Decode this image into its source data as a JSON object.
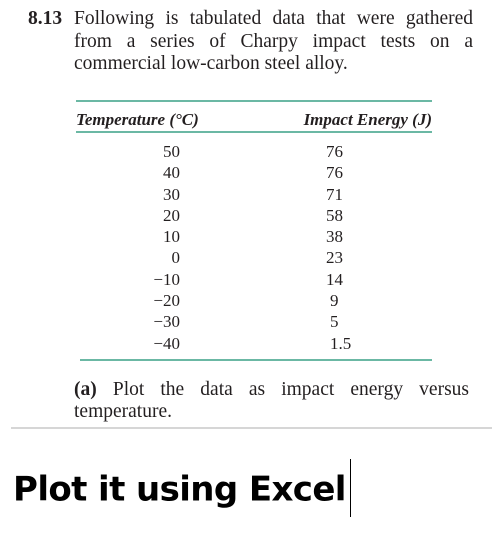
{
  "problem": {
    "number": "8.13",
    "statement": "Following is tabulated data that were gathered from a series of Charpy impact tests on a commercial low-carbon steel alloy."
  },
  "table": {
    "headers": {
      "temperature": "Temperature (°C)",
      "energy": "Impact Energy (J)"
    },
    "rows": [
      {
        "temperature": "50",
        "energy": "76"
      },
      {
        "temperature": "40",
        "energy": "76"
      },
      {
        "temperature": "30",
        "energy": "71"
      },
      {
        "temperature": "20",
        "energy": "58"
      },
      {
        "temperature": "10",
        "energy": "38"
      },
      {
        "temperature": "0",
        "energy": "23"
      },
      {
        "temperature": "−10",
        "energy": "14"
      },
      {
        "temperature": "−20",
        "energy": "9"
      },
      {
        "temperature": "−30",
        "energy": "5"
      },
      {
        "temperature": "−40",
        "energy": "1.5"
      }
    ],
    "rule_color": "#6bb8a4"
  },
  "question": {
    "label": "(a)",
    "text": "Plot the data as impact energy versus temperature."
  },
  "editor": {
    "typed_text": "Plot it using Excel",
    "caret_visible": true
  }
}
